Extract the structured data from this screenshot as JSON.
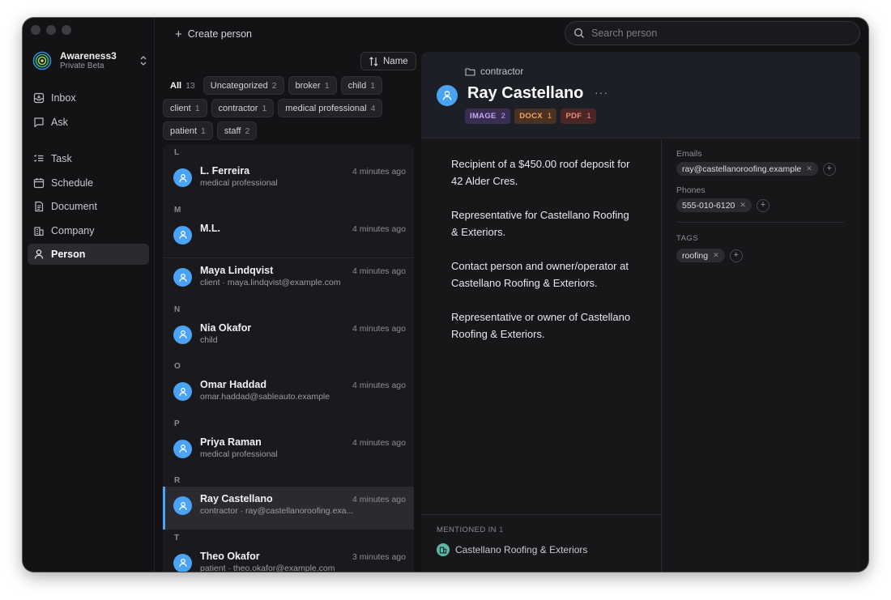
{
  "workspace": {
    "name": "Awareness3",
    "subtitle": "Private Beta"
  },
  "nav": [
    {
      "label": "Inbox",
      "icon": "inbox-icon"
    },
    {
      "label": "Ask",
      "icon": "chat-icon"
    },
    {
      "label": "Task",
      "icon": "task-icon"
    },
    {
      "label": "Schedule",
      "icon": "calendar-icon"
    },
    {
      "label": "Document",
      "icon": "document-icon"
    },
    {
      "label": "Company",
      "icon": "building-icon"
    },
    {
      "label": "Person",
      "icon": "person-icon",
      "active": true
    }
  ],
  "toolbar": {
    "create_label": "Create person",
    "search_placeholder": "Search person",
    "sort_label": "Name"
  },
  "filters": [
    {
      "label": "All",
      "count": "13",
      "active": true
    },
    {
      "label": "Uncategorized",
      "count": "2"
    },
    {
      "label": "broker",
      "count": "1"
    },
    {
      "label": "child",
      "count": "1"
    },
    {
      "label": "client",
      "count": "1"
    },
    {
      "label": "contractor",
      "count": "1"
    },
    {
      "label": "medical professional",
      "count": "4"
    },
    {
      "label": "patient",
      "count": "1"
    },
    {
      "label": "staff",
      "count": "2"
    }
  ],
  "list": [
    {
      "type": "section",
      "label": "L"
    },
    {
      "type": "row",
      "name": "L. Ferreira",
      "sub": "medical professional",
      "time": "4 minutes ago"
    },
    {
      "type": "section",
      "label": "M"
    },
    {
      "type": "row",
      "name": "M.L.",
      "sub": "",
      "time": "4 minutes ago"
    },
    {
      "type": "row",
      "name": "Maya Lindqvist",
      "sub": "client · maya.lindqvist@example.com",
      "time": "4 minutes ago"
    },
    {
      "type": "section",
      "label": "N"
    },
    {
      "type": "row",
      "name": "Nia Okafor",
      "sub": "child",
      "time": "4 minutes ago"
    },
    {
      "type": "section",
      "label": "O"
    },
    {
      "type": "row",
      "name": "Omar Haddad",
      "sub": "omar.haddad@sableauto.example",
      "time": "4 minutes ago"
    },
    {
      "type": "section",
      "label": "P"
    },
    {
      "type": "row",
      "name": "Priya Raman",
      "sub": "medical professional",
      "time": "4 minutes ago"
    },
    {
      "type": "section",
      "label": "R"
    },
    {
      "type": "row",
      "name": "Ray Castellano",
      "sub": "contractor · ray@castellanoroofing.exa...",
      "time": "4 minutes ago",
      "selected": true
    },
    {
      "type": "section",
      "label": "T"
    },
    {
      "type": "row",
      "name": "Theo Okafor",
      "sub": "patient · theo.okafor@example.com",
      "time": "3 minutes ago"
    }
  ],
  "detail": {
    "folder": "contractor",
    "name": "Ray Castellano",
    "more": "···",
    "badges": [
      {
        "label": "IMAGE",
        "count": "2",
        "bg": "#3a2d52",
        "fg": "#c7a6f5"
      },
      {
        "label": "DOCX",
        "count": "1",
        "bg": "#4a3222",
        "fg": "#f1a66a"
      },
      {
        "label": "PDF",
        "count": "1",
        "bg": "#4a2626",
        "fg": "#f08a7a"
      }
    ],
    "paragraphs": [
      "Recipient of a $450.00 roof deposit for 42 Alder Cres.",
      "Representative for Castellano Roofing & Exteriors.",
      "Contact person and owner/operator at Castellano Roofing & Exteriors.",
      "Representative or owner of Castellano Roofing & Exteriors."
    ],
    "mentioned_label": "MENTIONED IN",
    "mentioned_count": "1",
    "mentioned_item": "Castellano Roofing & Exteriors",
    "emails_label": "Emails",
    "email": "ray@castellanoroofing.example",
    "phones_label": "Phones",
    "phone": "555-010-6120",
    "tags_label": "TAGS",
    "tag": "roofing"
  },
  "colors": {
    "accent": "#4aa3f5",
    "company": "#5db8a2"
  }
}
